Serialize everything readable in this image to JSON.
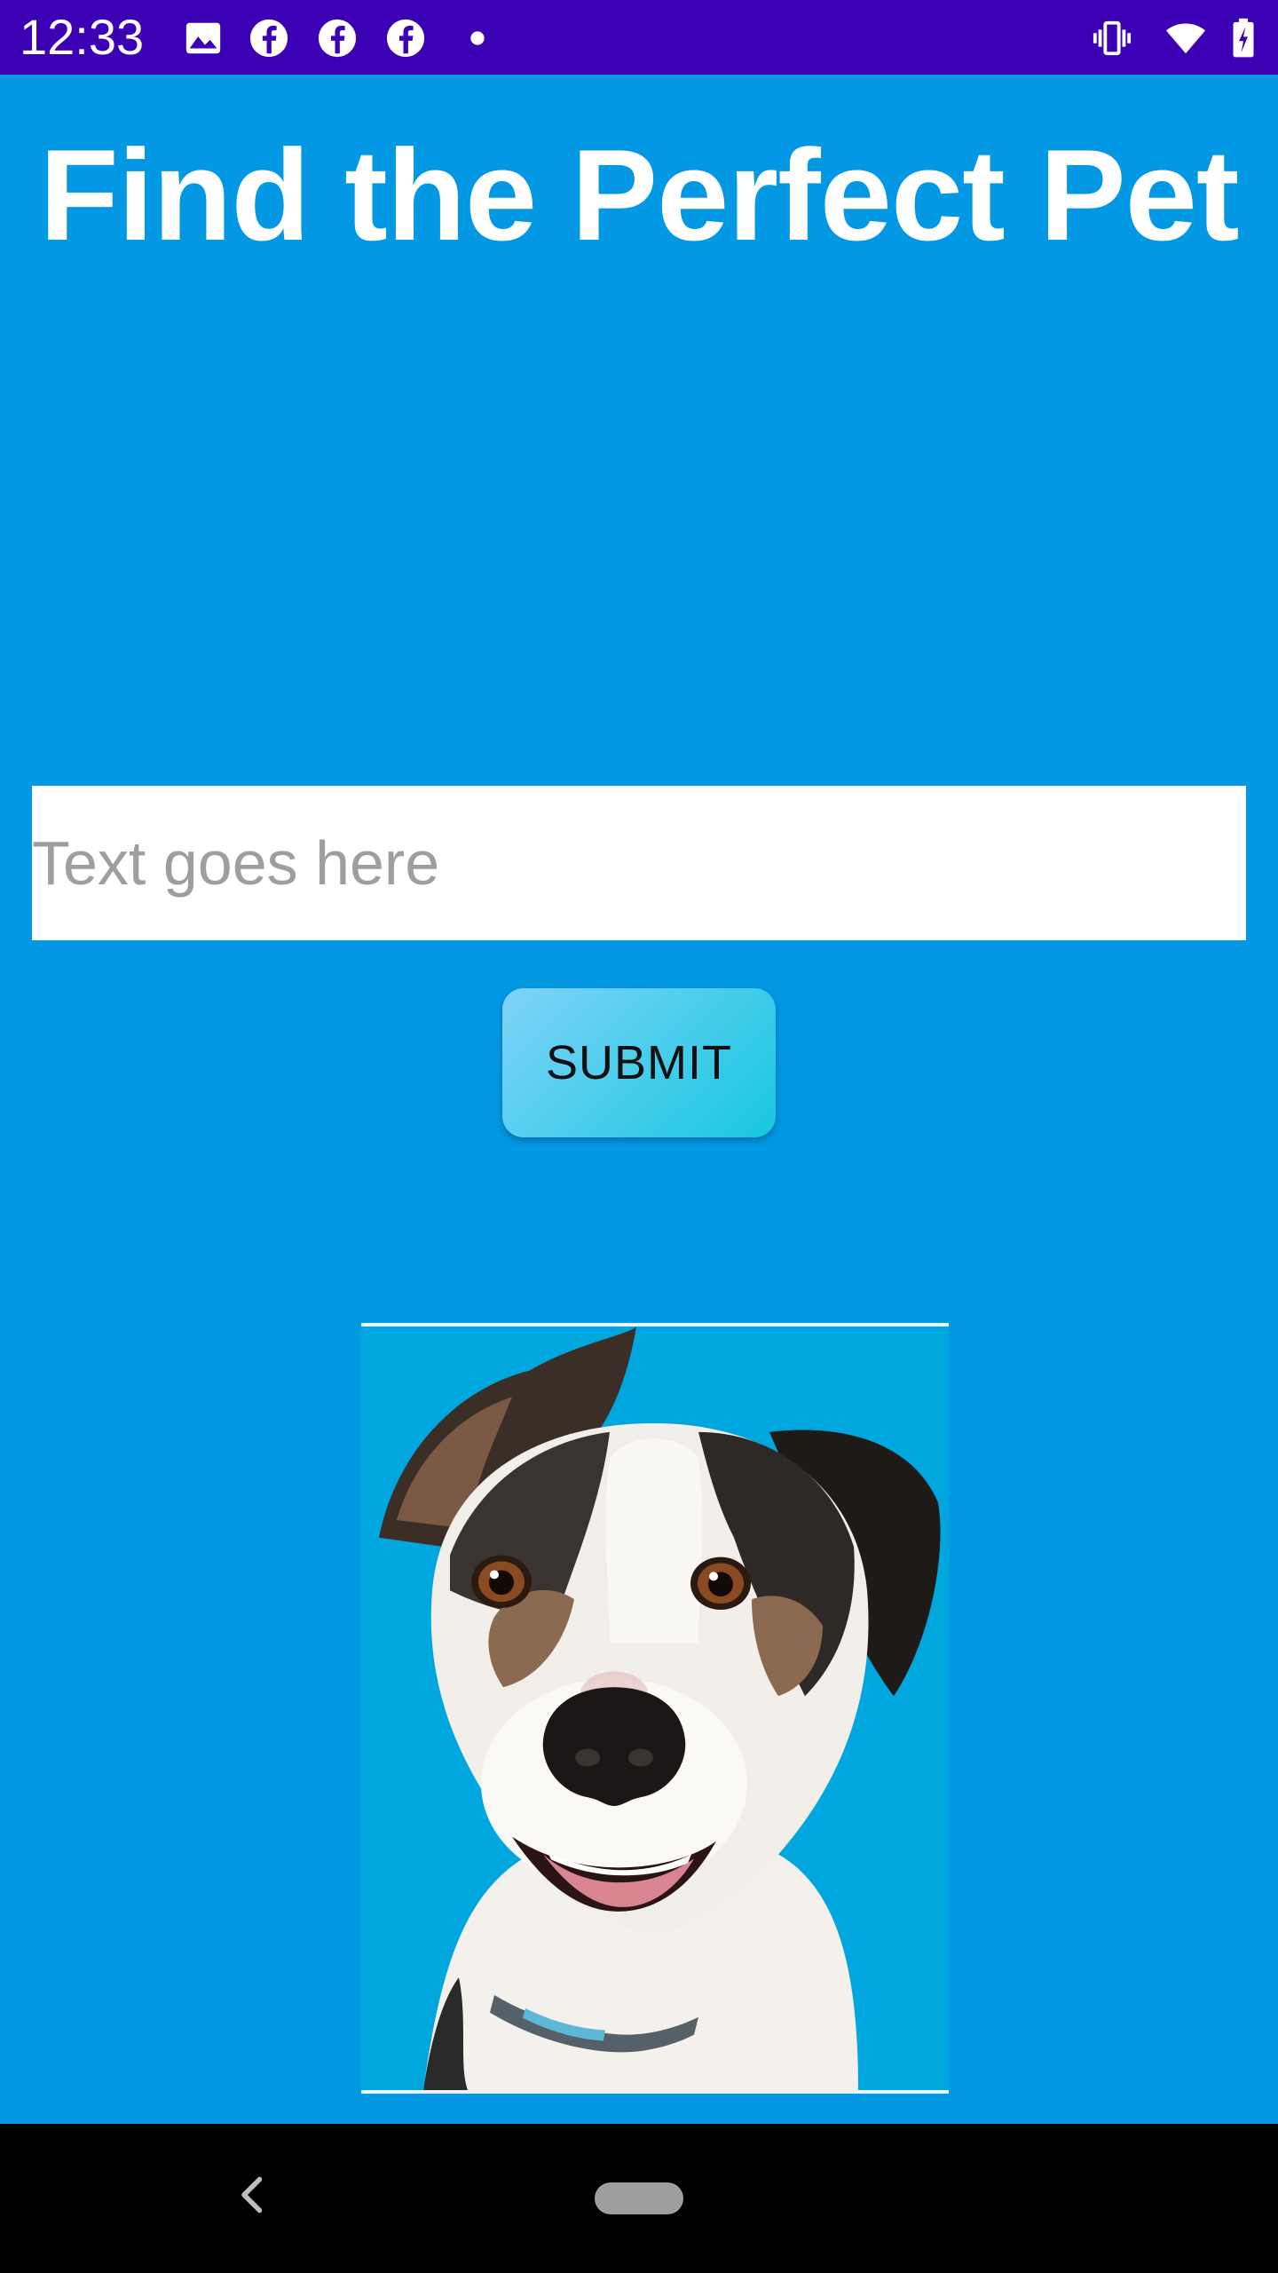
{
  "status_bar": {
    "time": "12:33",
    "left_icons": [
      "image-icon",
      "facebook-icon",
      "facebook-icon",
      "facebook-icon",
      "dot-icon"
    ],
    "right_icons": [
      "vibrate-icon",
      "wifi-icon",
      "battery-icon"
    ],
    "background": "#3C00B5"
  },
  "main": {
    "title": "Find the Perfect Pet",
    "input": {
      "value": "",
      "placeholder": "Text goes here"
    },
    "submit_label": "SUBMIT",
    "background": "#0398E4"
  },
  "nav_bar": {
    "icons": [
      "back-icon",
      "home-pill-icon"
    ]
  }
}
